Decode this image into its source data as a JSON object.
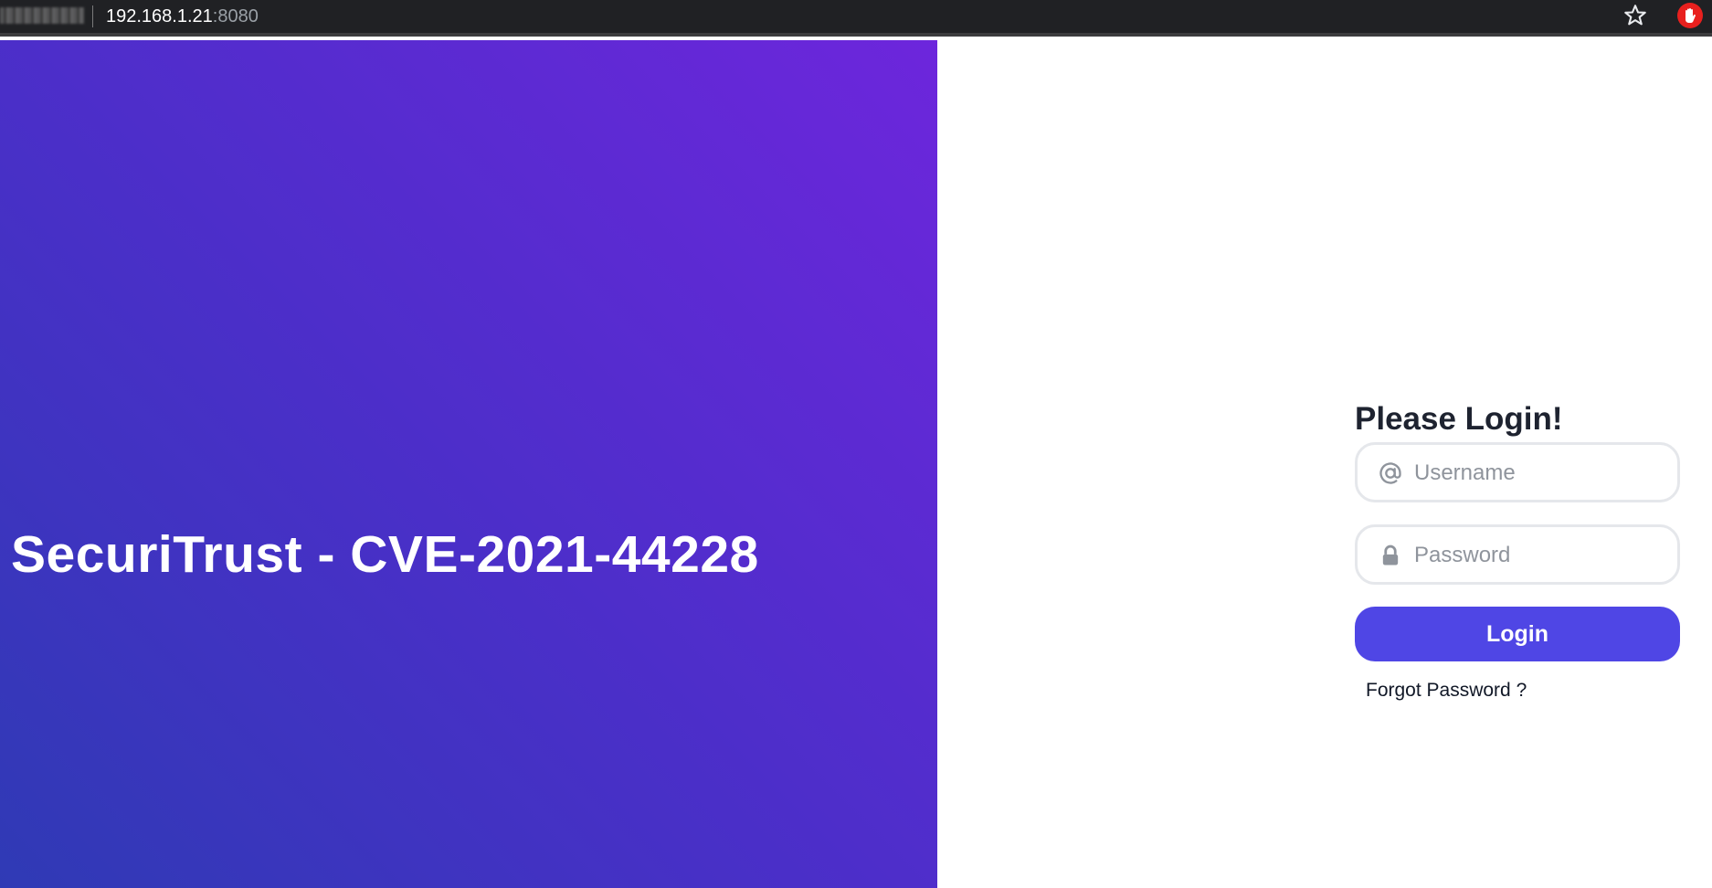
{
  "browser": {
    "url_host": "192.168.1.21",
    "url_port": ":8080",
    "icons": {
      "bookmark": "star-icon",
      "extension": "hand-stop-icon"
    }
  },
  "hero": {
    "title": "SecuriTrust - CVE-2021-44228",
    "gradient_colors": [
      "#2f3ab5",
      "#4a2fc8",
      "#6d26dc"
    ]
  },
  "login": {
    "title": "Please Login!",
    "username": {
      "placeholder": "Username",
      "value": "",
      "icon": "at-sign-icon"
    },
    "password": {
      "placeholder": "Password",
      "value": "",
      "icon": "lock-icon"
    },
    "button_label": "Login",
    "forgot_label": "Forgot Password ?",
    "accent_color": "#4f46e5"
  }
}
